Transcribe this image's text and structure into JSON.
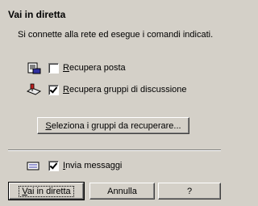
{
  "dialog": {
    "title": "Vai in diretta",
    "description": "Si connette alla rete ed esegue i comandi indicati."
  },
  "options": [
    {
      "label": "Recupera posta",
      "checked": false,
      "icon": "mail-icon"
    },
    {
      "label": "Recupera gruppi di discussione",
      "checked": true,
      "icon": "newsgroup-icon"
    }
  ],
  "select_groups_button": "Seleziona i gruppi  da recuperare...",
  "send_messages": {
    "label": "Invia messaggi",
    "checked": true,
    "icon": "outbox-icon"
  },
  "buttons": {
    "go_online": "Vai in diretta",
    "cancel": "Annulla",
    "help": "?"
  }
}
